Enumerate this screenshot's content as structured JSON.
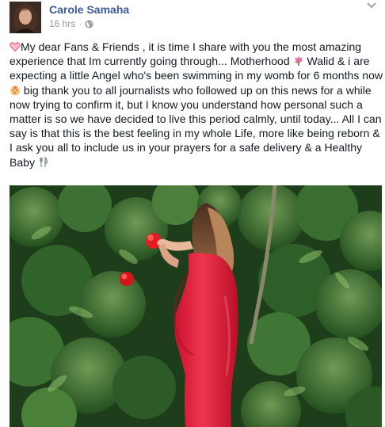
{
  "post": {
    "author": "Carole Samaha",
    "timestamp": "16 hrs",
    "separator": "·",
    "privacy_icon": "globe-icon",
    "menu_icon": "chevron-down-icon",
    "text_parts": [
      "My dear Fans & Friends , it is time I share with you the most amazing experience that Im currently going through... Motherhood ",
      " Walid & i are expecting a little Angel who's been swimming in my womb for 6 months now",
      " big thank you to all journalists who followed up on this news for a while now trying to confirm it, but I know you understand how personal such a matter is so we have decided to live this period calmly, until today... All I can say is that this is the best feeling in my whole Life, more like being reborn & I ask you all to include us in your prayers for a safe delivery & a Healthy Baby "
    ],
    "emoji_icons": [
      "heart-icon",
      "tulip-icon",
      "baby-icon",
      "fork-and-knife-icon"
    ]
  },
  "colors": {
    "author_link": "#3b5998",
    "meta_text": "#9197a3",
    "body_text": "#141823",
    "dress": "#e8243f",
    "foliage": "#2f6a2a"
  }
}
